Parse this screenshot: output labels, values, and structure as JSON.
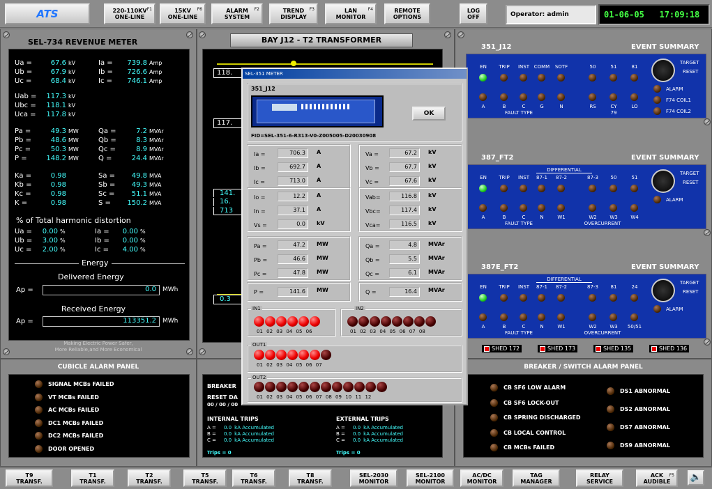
{
  "toolbar": {
    "logo": "ATS",
    "buttons": [
      {
        "l1": "220-110KV",
        "l2": "ONE-LINE",
        "fk": "F1"
      },
      {
        "l1": "15KV",
        "l2": "ONE-LINE",
        "fk": "F6"
      },
      {
        "l1": "ALARM",
        "l2": "SYSTEM",
        "fk": "F2"
      },
      {
        "l1": "TREND",
        "l2": "DISPLAY",
        "fk": "F3"
      },
      {
        "l1": "LAN",
        "l2": "MONITOR",
        "fk": "F4"
      },
      {
        "l1": "REMOTE",
        "l2": "OPTIONS",
        "fk": ""
      },
      {
        "l1": "LOG",
        "l2": "OFF",
        "fk": ""
      }
    ],
    "operator": "Operator: admin",
    "date": "01-06-05",
    "time": "17:09:18"
  },
  "meter": {
    "title": "SEL-734 REVENUE METER",
    "left": [
      [
        "Ua =",
        "67.6",
        "kV"
      ],
      [
        "Ub =",
        "67.9",
        "kV"
      ],
      [
        "Uc =",
        "68.4",
        "kV"
      ],
      [
        "Uab =",
        "117.3",
        "kV"
      ],
      [
        "Ubc =",
        "118.1",
        "kV"
      ],
      [
        "Uca =",
        "117.8",
        "kV"
      ],
      [
        "Pa =",
        "49.3",
        "MW"
      ],
      [
        "Pb =",
        "48.6",
        "MW"
      ],
      [
        "Pc =",
        "50.3",
        "MW"
      ],
      [
        "P =",
        "148.2",
        "MW"
      ],
      [
        "Ka =",
        "0.98",
        ""
      ],
      [
        "Kb =",
        "0.98",
        ""
      ],
      [
        "Kc =",
        "0.98",
        ""
      ],
      [
        "K =",
        "0.98",
        ""
      ]
    ],
    "right": [
      [
        "Ia =",
        "739.8",
        "Amp"
      ],
      [
        "Ib =",
        "726.6",
        "Amp"
      ],
      [
        "Ic =",
        "746.1",
        "Amp"
      ],
      [
        "Qa =",
        "7.2",
        "MVAr"
      ],
      [
        "Qb =",
        "8.3",
        "MVAr"
      ],
      [
        "Qc =",
        "8.9",
        "MVAr"
      ],
      [
        "Q =",
        "24.4",
        "MVAr"
      ],
      [
        "Sa =",
        "49.8",
        "MVA"
      ],
      [
        "Sb =",
        "49.3",
        "MVA"
      ],
      [
        "Sc =",
        "51.1",
        "MVA"
      ],
      [
        "S =",
        "150.2",
        "MVA"
      ]
    ],
    "thd_title": "% of Total harmonic distortion",
    "thd": [
      [
        "Ua =",
        "0.00",
        "%",
        "Ia =",
        "0.00",
        "%"
      ],
      [
        "Ub =",
        "3.00",
        "%",
        "Ib =",
        "0.00",
        "%"
      ],
      [
        "Uc =",
        "2.00",
        "%",
        "Ic =",
        "4.00",
        "%"
      ]
    ],
    "energy": "Energy",
    "delivered": "Delivered Energy",
    "ap_label": "Ap =",
    "ap_del": "0.0",
    "unit": "MWh",
    "received": "Received Energy",
    "ap_rec": "113351.2",
    "slogan1": "Making Electric Power Safer,",
    "slogan2": "More Reliable,and More Economical"
  },
  "bay": {
    "title": "BAY J12 - T2 TRANSFORMER",
    "v1": "118.",
    "v2": "117.",
    "v3": "141.",
    "v4": "16.",
    "v5": "713",
    "v6": "0.3"
  },
  "relays": [
    {
      "name": "351_J12",
      "summary": "EVENT SUMMARY",
      "top": [
        "EN",
        "TRIP",
        "INST",
        "COMM",
        "SOTF",
        "50",
        "51",
        "81"
      ],
      "bottom": [
        "A",
        "B",
        "C",
        "G",
        "N",
        "RS",
        "CY",
        "LO"
      ],
      "group": "FAULT TYPE",
      "extra": "79",
      "right": [
        "TARGET",
        "RESET",
        "ALARM",
        "F74 COIL1",
        "F74 COIL2"
      ]
    },
    {
      "name": "387_FT2",
      "summary": "EVENT SUMMARY",
      "top": [
        "EN",
        "TRIP",
        "INST",
        "87-1",
        "87-2",
        "87-3",
        "50",
        "51"
      ],
      "bottom": [
        "A",
        "B",
        "C",
        "N",
        "W1",
        "W2",
        "W3",
        "W4"
      ],
      "group": "FAULT TYPE",
      "group2": "OVERCURRENT",
      "diff": "DIFFERENTIAL",
      "right": [
        "TARGET",
        "RESET",
        "ALARM"
      ]
    },
    {
      "name": "387E_FT2",
      "summary": "EVENT SUMMARY",
      "top": [
        "EN",
        "TRIP",
        "INST",
        "87-1",
        "87-2",
        "87-3",
        "81",
        "24"
      ],
      "bottom": [
        "A",
        "B",
        "C",
        "N",
        "W1",
        "W2",
        "W3",
        "50/51"
      ],
      "group": "FAULT TYPE",
      "group2": "OVERCURRENT",
      "diff": "DIFFERENTIAL",
      "right": [
        "TARGET",
        "RESET",
        "ALARM"
      ]
    }
  ],
  "sheds": [
    "SHED 172",
    "SHED 173",
    "SHED 135",
    "SHED 136"
  ],
  "cubicle": {
    "title": "CUBICLE ALARM PANEL",
    "items": [
      "SIGNAL MCBs FAILED",
      "VT MCBs FAILED",
      "AC MCBs FAILED",
      "DC1 MCBs FAILED",
      "DC2 MCBs FAILED",
      "DOOR OPENED"
    ]
  },
  "breaker_mid": {
    "title": "BREAKER",
    "reset": "RESET DA",
    "reset_val": "00 / 00 / 00",
    "int": "INTERNAL TRIPS",
    "ext": "EXTERNAL TRIPS",
    "rows": [
      [
        "A =",
        "0.0",
        "kA Accumulated"
      ],
      [
        "B =",
        "0.0",
        "kA Accumulated"
      ],
      [
        "C =",
        "0.0",
        "kA Accumulated"
      ]
    ],
    "trips": "Trips = 0"
  },
  "bsw": {
    "title": "BREAKER / SWITCH ALARM PANEL",
    "left": [
      "CB SF6 LOW ALARM",
      "CB SF6 LOCK-OUT",
      "CB SPRING DISCHARGED",
      "CB LOCAL CONTROL",
      "CB MCBs FAILED"
    ],
    "right": [
      "DS1 ABNORMAL",
      "DS2 ABNORMAL",
      "DS7 ABNORMAL",
      "DS9 ABNORMAL"
    ]
  },
  "dialog": {
    "title": "SEL-351 METER",
    "name": "351_J12",
    "ok": "OK",
    "fid": "FID=SEL-351-6-R313-V0-Z005005-D20030908",
    "I": [
      [
        "Ia =",
        "706.3",
        "A"
      ],
      [
        "Ib =",
        "692.7",
        "A"
      ],
      [
        "Ic =",
        "713.0",
        "A"
      ]
    ],
    "V": [
      [
        "Va =",
        "67.2",
        "kV"
      ],
      [
        "Vb =",
        "67.7",
        "kV"
      ],
      [
        "Vc =",
        "67.6",
        "kV"
      ]
    ],
    "I2": [
      [
        "Io =",
        "12.2",
        "A"
      ],
      [
        "In =",
        "37.1",
        "A"
      ],
      [
        "Vs =",
        "0.0",
        "kV"
      ]
    ],
    "VL": [
      [
        "Vab=",
        "116.8",
        "kV"
      ],
      [
        "Vbc=",
        "117.4",
        "kV"
      ],
      [
        "Vca=",
        "116.5",
        "kV"
      ]
    ],
    "P": [
      [
        "Pa =",
        "47.2",
        "MW"
      ],
      [
        "Pb =",
        "46.6",
        "MW"
      ],
      [
        "Pc =",
        "47.8",
        "MW"
      ]
    ],
    "Q": [
      [
        "Qa =",
        "4.8",
        "MVAr"
      ],
      [
        "Qb =",
        "5.5",
        "MVAr"
      ],
      [
        "Qc =",
        "6.1",
        "MVAr"
      ]
    ],
    "Ptot": [
      "P =",
      "141.6",
      "MW"
    ],
    "Qtot": [
      "Q =",
      "16.4",
      "MVAr"
    ],
    "in1": "IN1",
    "in2": "IN2",
    "out1": "OUT1",
    "out2": "OUT2",
    "in1n": "01 02 03 04 05 06",
    "in2n": "01 02 03 04 05 06 07 08",
    "out1n": "01 02 03 04 05 06 07",
    "out2n": "01 02 03 04 05 06 07 08 09 10 11 12"
  },
  "bottombar": [
    [
      "T9",
      "TRANSF."
    ],
    [
      "T1",
      "TRANSF."
    ],
    [
      "T2",
      "TRANSF."
    ],
    [
      "T5",
      "TRANSF."
    ],
    [
      "T6",
      "TRANSF."
    ],
    [
      "T8",
      "TRANSF."
    ],
    [
      "SEL-2030",
      "MONITOR"
    ],
    [
      "SEL-2100",
      "MONITOR"
    ],
    [
      "AC/DC",
      "MONITOR"
    ],
    [
      "TAG",
      "MANAGER"
    ],
    [
      "RELAY",
      "SERVICE"
    ],
    [
      "ACK",
      "AUDIBLE"
    ]
  ],
  "ack_fk": "F5"
}
